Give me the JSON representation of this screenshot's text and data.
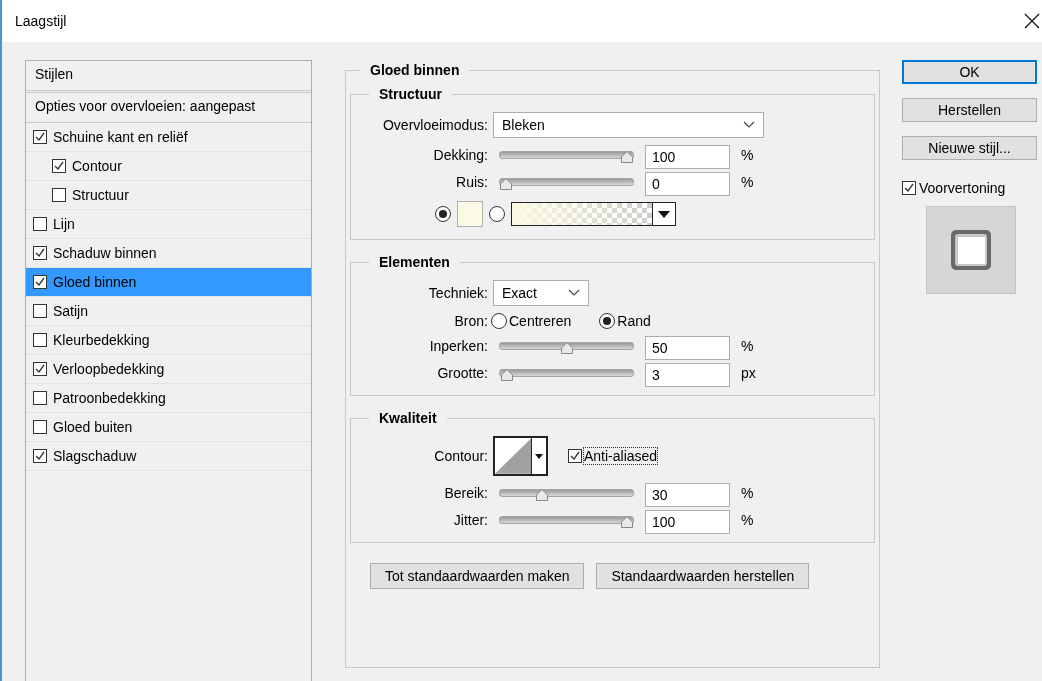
{
  "window": {
    "title": "Laagstijl"
  },
  "styles_panel": {
    "header": "Stijlen",
    "blending_options": "Opties voor overvloeien: aangepast",
    "items": [
      {
        "label": "Schuine kant en reliëf",
        "checked": true,
        "selected": false,
        "children": [
          {
            "label": "Contour",
            "checked": true,
            "selected": false
          },
          {
            "label": "Structuur",
            "checked": false,
            "selected": false
          }
        ]
      },
      {
        "label": "Lijn",
        "checked": false,
        "selected": false
      },
      {
        "label": "Schaduw binnen",
        "checked": true,
        "selected": false
      },
      {
        "label": "Gloed binnen",
        "checked": true,
        "selected": true
      },
      {
        "label": "Satijn",
        "checked": false,
        "selected": false
      },
      {
        "label": "Kleurbedekking",
        "checked": false,
        "selected": false
      },
      {
        "label": "Verloopbedekking",
        "checked": true,
        "selected": false
      },
      {
        "label": "Patroonbedekking",
        "checked": false,
        "selected": false
      },
      {
        "label": "Gloed buiten",
        "checked": false,
        "selected": false
      },
      {
        "label": "Slagschaduw",
        "checked": true,
        "selected": false
      }
    ]
  },
  "settings": {
    "title": "Gloed binnen",
    "sections": [
      {
        "title": "Structuur",
        "rows": [
          {
            "kind": "select",
            "label": "Overvloeimodus:",
            "value": "Bleken"
          },
          {
            "kind": "slider",
            "label": "Dekking:",
            "level": 1.0,
            "value": "100",
            "unit": "%"
          },
          {
            "kind": "slider",
            "label": "Ruis:",
            "level": 0,
            "value": "0",
            "unit": "%"
          },
          {
            "kind": "fill",
            "options": [
              {
                "kind": "swatch",
                "selected": true,
                "color": "#fbfae4"
              },
              {
                "kind": "gradient",
                "selected": false
              }
            ]
          }
        ]
      },
      {
        "title": "Elementen",
        "rows": [
          {
            "kind": "select",
            "label": "Techniek:",
            "value": "Exact"
          },
          {
            "kind": "radios",
            "label": "Bron:",
            "options": [
              {
                "label": "Centreren",
                "selected": false
              },
              {
                "label": "Rand",
                "selected": true
              }
            ]
          },
          {
            "kind": "slider",
            "label": "Inperken:",
            "level": 0.5,
            "value": "50",
            "unit": "%"
          },
          {
            "kind": "slider",
            "label": "Grootte:",
            "level": 0.012,
            "value": "3",
            "unit": "px"
          }
        ]
      },
      {
        "title": "Kwaliteit",
        "rows": [
          {
            "kind": "contour",
            "label": "Contour:",
            "checkbox": {
              "label": "Anti-aliased",
              "checked": true
            }
          },
          {
            "kind": "slider",
            "label": "Bereik:",
            "level": 0.3,
            "value": "30",
            "unit": "%"
          },
          {
            "kind": "slider",
            "label": "Jitter:",
            "level": 1.0,
            "value": "100",
            "unit": "%"
          }
        ]
      }
    ],
    "buttons": [
      "Tot standaardwaarden maken",
      "Standaardwaarden herstellen"
    ]
  },
  "actions": {
    "buttons": [
      {
        "label": "OK",
        "default": true
      },
      {
        "label": "Herstellen",
        "default": false
      },
      {
        "label": "Nieuwe stijl...",
        "default": false
      }
    ],
    "preview": {
      "label": "Voorvertoning",
      "checked": true
    }
  }
}
